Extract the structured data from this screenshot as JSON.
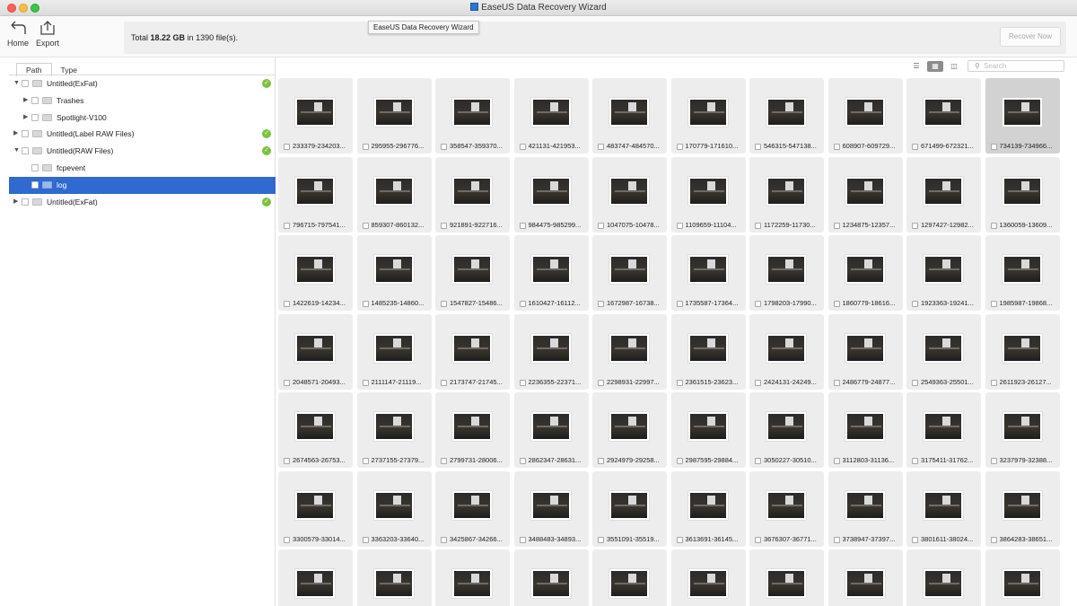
{
  "window": {
    "title": "EaseUS Data Recovery Wizard",
    "tooltip": "EaseUS Data Recovery Wizard"
  },
  "toolbar": {
    "home_label": "Home",
    "export_label": "Export"
  },
  "summary": {
    "prefix": "Total ",
    "size": "18.22 GB",
    "middle": " in ",
    "count": "1390",
    "suffix": " file(s).",
    "recover_label": "Recover Now"
  },
  "tabs": [
    {
      "label": "Path"
    },
    {
      "label": "Type"
    }
  ],
  "search": {
    "placeholder": "Search"
  },
  "tree": [
    {
      "label": "Untitled(ExFat)",
      "level": 0,
      "expanded": true,
      "status": "ok"
    },
    {
      "label": "Trashes",
      "level": 1,
      "expanded": false,
      "status": ""
    },
    {
      "label": "Spotlight-V100",
      "level": 1,
      "expanded": false,
      "status": ""
    },
    {
      "label": "Untitled(Label RAW Files)",
      "level": 0,
      "expanded": false,
      "status": "ok"
    },
    {
      "label": "Untitled(RAW Files)",
      "level": 0,
      "expanded": true,
      "status": "ok"
    },
    {
      "label": "fcpevent",
      "level": 1,
      "expanded": false,
      "status": ""
    },
    {
      "label": "log",
      "level": 1,
      "expanded": false,
      "status": "",
      "selected": true
    },
    {
      "label": "Untitled(ExFat)",
      "level": 0,
      "expanded": false,
      "status": "ok"
    }
  ],
  "files": [
    "233379-234203...",
    "295955-296776...",
    "358547-359370...",
    "421131-421953...",
    "483747-484570...",
    "170779-171610...",
    "546315-547138...",
    "608907-609729...",
    "671499-672321...",
    "734139-734966...",
    "796715-797541...",
    "859307-860132...",
    "921891-922716...",
    "984475-985299...",
    "1047075-10478...",
    "1109659-11104...",
    "1172259-11730...",
    "1234875-12357...",
    "1297427-12982...",
    "1360059-13609...",
    "1422619-14234...",
    "1485235-14860...",
    "1547827-15486...",
    "1610427-16112...",
    "1672987-16738...",
    "1735587-17364...",
    "1798203-17990...",
    "1860779-18616...",
    "1923363-19241...",
    "1985987-19868...",
    "2048571-20493...",
    "2111147-21119...",
    "2173747-21745...",
    "2236355-22371...",
    "2298931-22997...",
    "2361515-23623...",
    "2424131-24249...",
    "2486779-24877...",
    "2549363-25501...",
    "2611923-26127...",
    "2674563-26753...",
    "2737155-27379...",
    "2799731-28006...",
    "2862347-28631...",
    "2924979-29258...",
    "2987595-29884...",
    "3050227-30510...",
    "3112803-31136...",
    "3175411-31762...",
    "3237979-32388...",
    "3300579-33014...",
    "3363203-33640...",
    "3425867-34266...",
    "3488483-34893...",
    "3551091-35519...",
    "3613691-36145...",
    "3676307-36771...",
    "3738947-37397...",
    "3801611-38024...",
    "3864283-38651...",
    "",
    "",
    "",
    "",
    "",
    "",
    "",
    "",
    "",
    ""
  ],
  "selected_file_index": 9
}
